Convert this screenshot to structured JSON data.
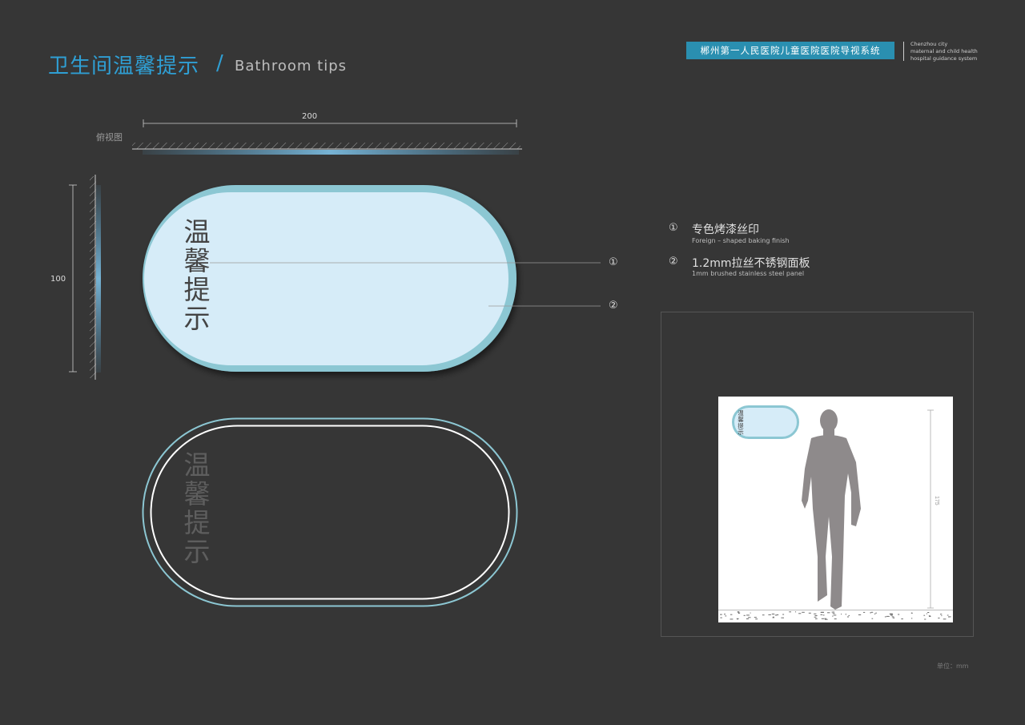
{
  "header": {
    "title_cn": "卫生间温馨提示",
    "slash": "/",
    "title_en": "Bathroom tips",
    "project_cn": "郴州第一人民医院儿童医院医院导视系统",
    "project_en": [
      "Chenzhou city",
      "maternal and child health",
      "hospital guidance system"
    ]
  },
  "top_view": {
    "label": "俯视图",
    "width_dim": "200"
  },
  "side_view": {
    "height_dim": "100"
  },
  "sign": {
    "text_chars": [
      "温",
      "馨",
      "提",
      "示"
    ]
  },
  "callouts": [
    "①",
    "②"
  ],
  "legend": [
    {
      "num": "①",
      "cn": "专色烤漆丝印",
      "en": "Foreign – shaped baking finish"
    },
    {
      "num": "②",
      "cn": "1.2mm拉丝不锈钢面板",
      "en": "1mm brushed stainless steel panel"
    }
  ],
  "scene": {
    "height_dim": "175",
    "mini_sign_text": "温馨提示"
  },
  "unit_label": "单位：mm",
  "colors": {
    "background": "#363636",
    "accent_blue": "#2f9fd4",
    "sign_face": "#d6ecf8",
    "sign_border": "#8cc7d3",
    "silhouette": "#8e8a8b"
  }
}
